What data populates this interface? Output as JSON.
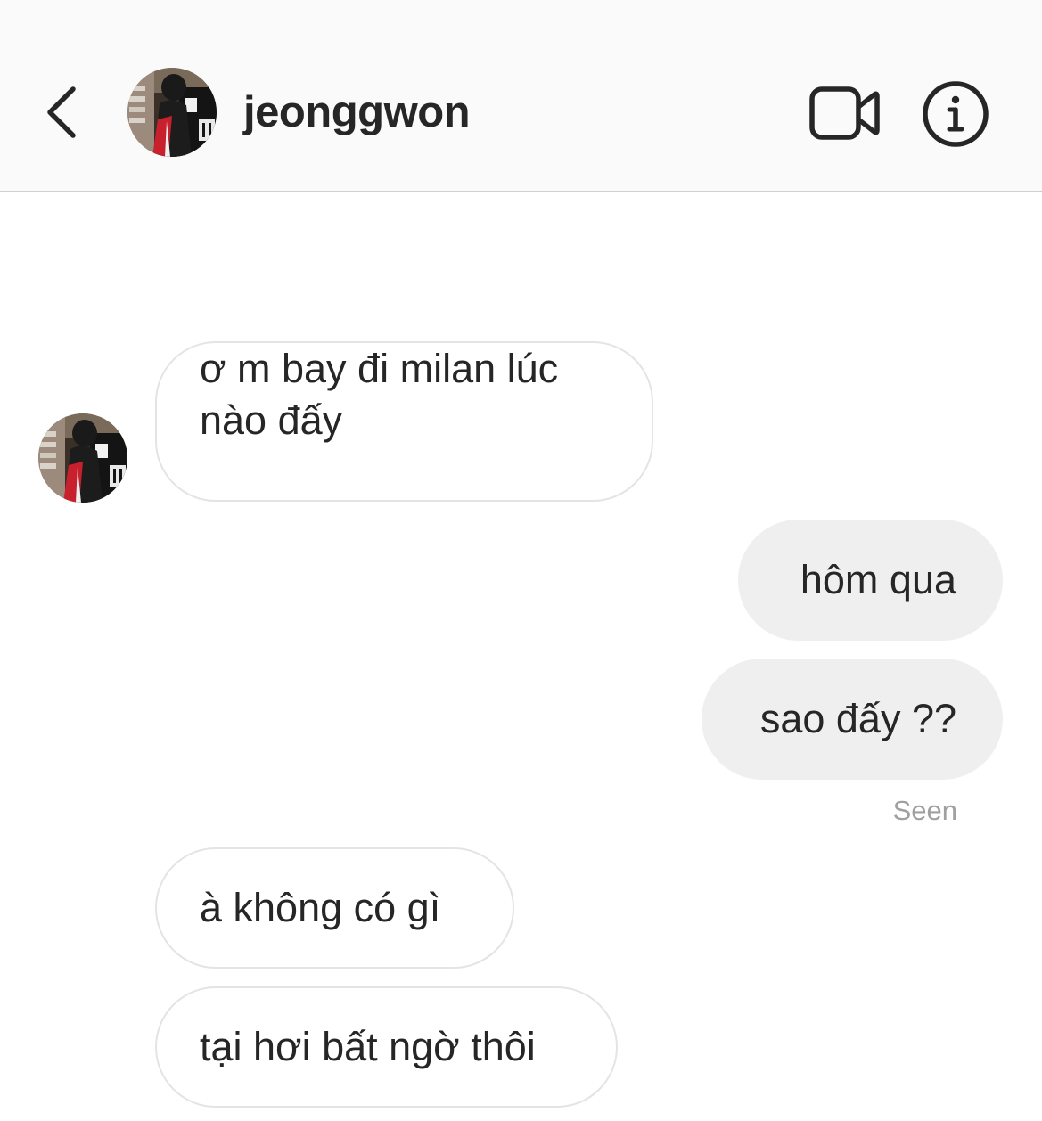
{
  "header": {
    "username": "jeonggwon",
    "back_icon": "chevron-left-icon",
    "video_icon": "video-camera-icon",
    "info_icon": "info-icon"
  },
  "messages": [
    {
      "direction": "incoming",
      "text": "ơ m bay đi milan lúc nào đấy"
    },
    {
      "direction": "outgoing",
      "text": "hôm qua"
    },
    {
      "direction": "outgoing",
      "text": "sao đấy ??"
    },
    {
      "direction": "incoming",
      "text": "à không có gì"
    },
    {
      "direction": "incoming",
      "text": "tại hơi bất ngờ thôi"
    }
  ],
  "status": {
    "seen": "Seen"
  },
  "colors": {
    "header_bg": "#fafafa",
    "outgoing_bubble": "#efefef",
    "incoming_border": "#e4e4e4",
    "text": "#262626",
    "seen_text": "#a0a0a0"
  }
}
